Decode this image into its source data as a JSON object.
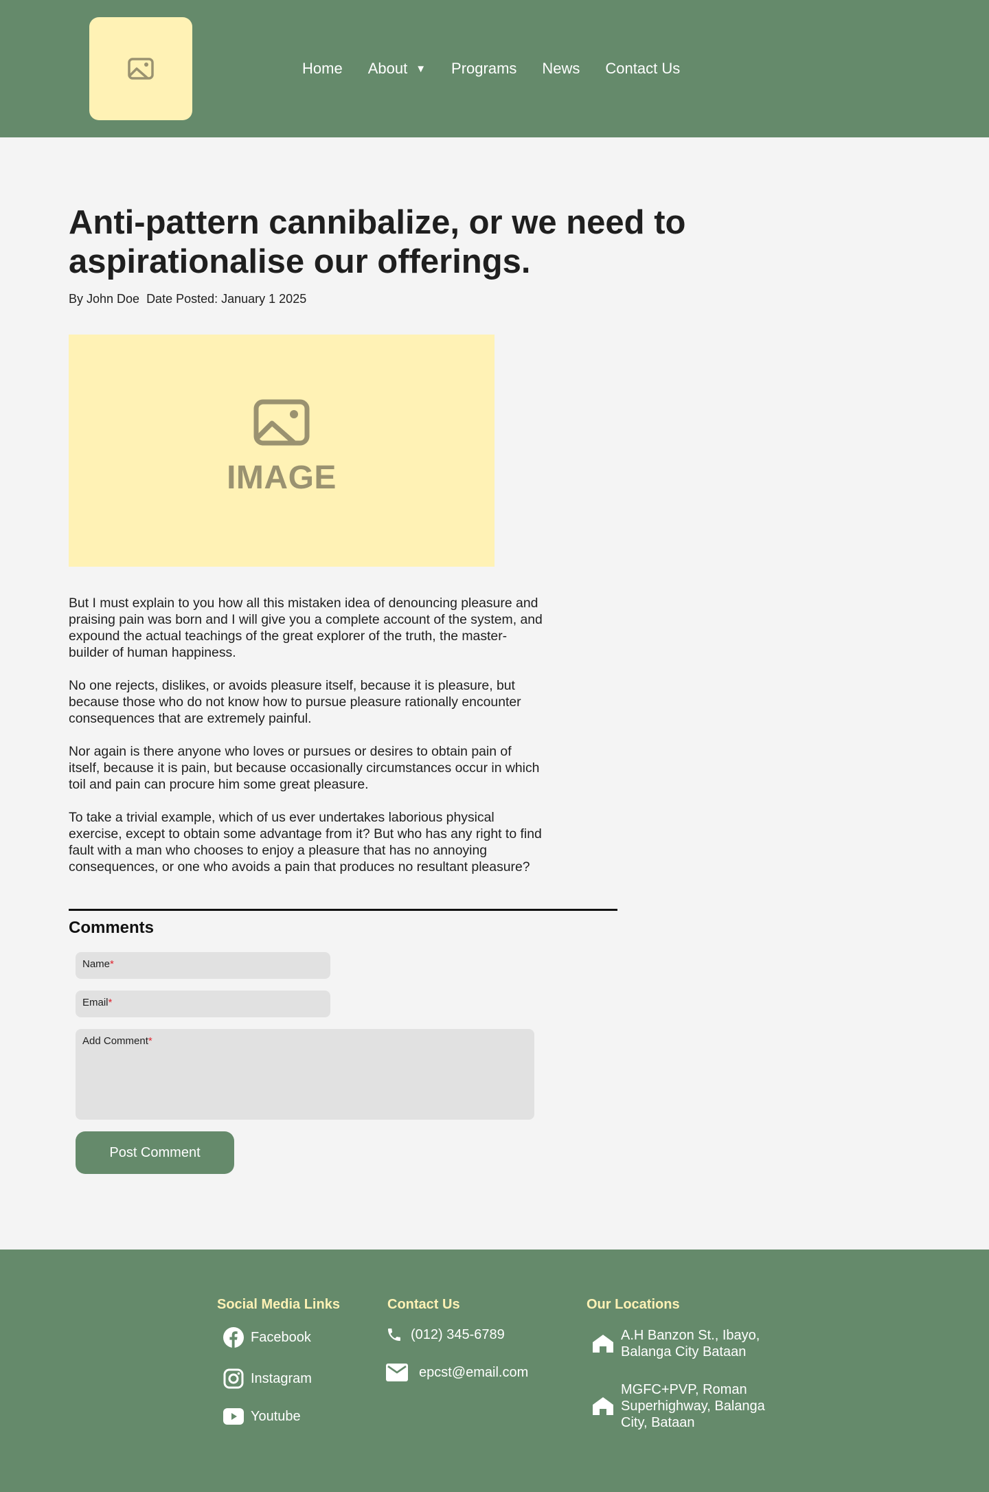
{
  "header": {
    "logo_icon": "image-placeholder-icon",
    "nav": [
      {
        "label": "Home"
      },
      {
        "label": "About",
        "has_dropdown": true
      },
      {
        "label": "Programs"
      },
      {
        "label": "News"
      },
      {
        "label": "Contact Us"
      }
    ]
  },
  "article": {
    "title": "Anti-pattern cannibalize, or we need to aspirationalise our offerings.",
    "author": "By John Doe",
    "date": "Date Posted: January 1 2025",
    "image_label": "IMAGE",
    "paragraphs": [
      "But I must explain to you how all this mistaken idea of denouncing pleasure and praising pain was born and I will give you a complete account of the system, and expound the actual teachings of the great explorer of the truth, the master-builder of human happiness.",
      "No one rejects, dislikes, or avoids pleasure itself, because it is pleasure, but because those who do not know how to pursue pleasure rationally encounter consequences that are extremely painful.",
      "Nor again is there anyone who loves or pursues or desires to obtain pain of itself, because it is pain, but because occasionally circumstances occur in which toil and pain can procure him some great pleasure.",
      "To take a trivial example, which of us ever undertakes laborious physical exercise, except to obtain some advantage from it? But who has any right to find fault with a man who chooses to enjoy a pleasure that has no annoying consequences, or one who avoids a pain that produces no resultant pleasure?"
    ]
  },
  "comments": {
    "title": "Comments",
    "name_label": "Name",
    "email_label": "Email",
    "comment_label": "Add Comment",
    "required_mark": "*",
    "submit_label": "Post Comment"
  },
  "footer": {
    "social_title": "Social Media Links",
    "social": [
      {
        "label": "Facebook",
        "icon": "facebook-icon"
      },
      {
        "label": "Instagram",
        "icon": "instagram-icon"
      },
      {
        "label": "Youtube",
        "icon": "youtube-icon"
      }
    ],
    "contact_title": "Contact Us",
    "phone": "(012) 345-6789",
    "email": "epcst@email.com",
    "locations_title": "Our Locations",
    "locations": [
      "A.H Banzon St., Ibayo, Balanga City Bataan",
      "MGFC+PVP, Roman Superhighway, Balanga City, Bataan"
    ]
  },
  "colors": {
    "brand_green": "#658a6b",
    "accent_yellow": "#fff2b5",
    "required_red": "#e0242e",
    "background": "#f4f4f4"
  }
}
